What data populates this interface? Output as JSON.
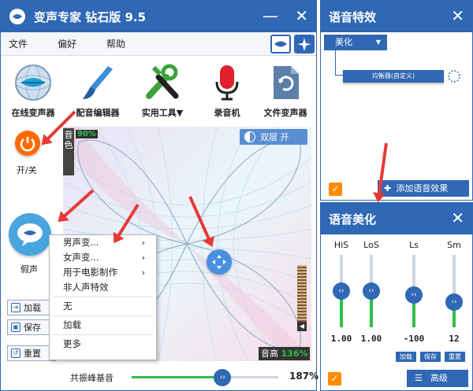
{
  "main": {
    "title": "变声专家 钻石版 9.5",
    "menu": [
      "文件",
      "偏好",
      "帮助"
    ],
    "tools": [
      {
        "label": "在线变声器",
        "icon": "lips-globe-icon"
      },
      {
        "label": "配音编辑器",
        "icon": "paintbrush-icon"
      },
      {
        "label": "实用工具▼",
        "icon": "tools-icon"
      },
      {
        "label": "录音机",
        "icon": "microphone-icon"
      },
      {
        "label": "文件变声器",
        "icon": "file-refresh-icon"
      }
    ],
    "power_label": "开/关",
    "fake_label": "假声",
    "timbre_label": "音色",
    "timbre_value": "90%",
    "dual_label": "双层 开",
    "pitch_label": "音高",
    "pitch_value": "136%",
    "resonance_label": "共振峰基音",
    "resonance_value": "187%",
    "resonance_level": 0.62,
    "pitch_meter_level": 0.55,
    "side_buttons": {
      "load": "加载",
      "save": "保存",
      "reset": "重置"
    }
  },
  "context_menu": {
    "items": [
      {
        "label": "男声变...",
        "submenu": true
      },
      {
        "label": "女声变...",
        "submenu": true
      },
      {
        "label": "用于电影制作",
        "submenu": true
      },
      {
        "label": "非人声特效",
        "submenu": false
      }
    ],
    "items2": [
      "无",
      "加载",
      "更多"
    ]
  },
  "effects": {
    "title": "语音特效",
    "dropdown": "美化",
    "node": "均衡器(自定义)",
    "add_label": "添加语音效果"
  },
  "beauty": {
    "title": "语音美化",
    "sliders": [
      {
        "name": "HiS",
        "value": "1.00",
        "level": 0.5
      },
      {
        "name": "LoS",
        "value": "1.00",
        "level": 0.5
      },
      {
        "name": "Ls",
        "value": "-100",
        "level": 0.45
      },
      {
        "name": "Sm",
        "value": "12",
        "level": 0.35
      }
    ],
    "buttons": [
      "加载",
      "保存",
      "重置"
    ],
    "advanced": "高级"
  },
  "colors": {
    "accent": "#2f68b4",
    "orange": "#ff6a00",
    "arrow": "#e53935",
    "green": "#2ec04a"
  }
}
